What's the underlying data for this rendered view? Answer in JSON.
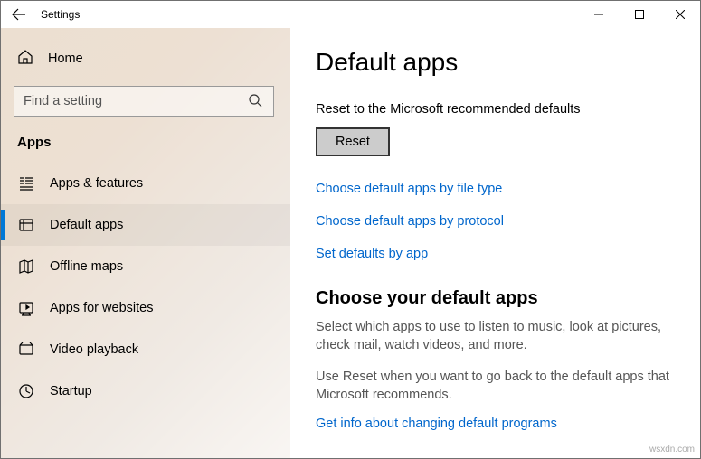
{
  "titlebar": {
    "title": "Settings"
  },
  "sidebar": {
    "home": "Home",
    "search_placeholder": "Find a setting",
    "section": "Apps",
    "items": [
      {
        "label": "Apps & features"
      },
      {
        "label": "Default apps"
      },
      {
        "label": "Offline maps"
      },
      {
        "label": "Apps for websites"
      },
      {
        "label": "Video playback"
      },
      {
        "label": "Startup"
      }
    ]
  },
  "main": {
    "title": "Default apps",
    "reset_caption": "Reset to the Microsoft recommended defaults",
    "reset_button": "Reset",
    "links": {
      "by_filetype": "Choose default apps by file type",
      "by_protocol": "Choose default apps by protocol",
      "by_app": "Set defaults by app"
    },
    "section2_title": "Choose your default apps",
    "para1": "Select which apps to use to listen to music, look at pictures, check mail, watch videos, and more.",
    "para2": "Use Reset when you want to go back to the default apps that Microsoft recommends.",
    "info_link": "Get info about changing default programs"
  },
  "watermark": "wsxdn.com"
}
